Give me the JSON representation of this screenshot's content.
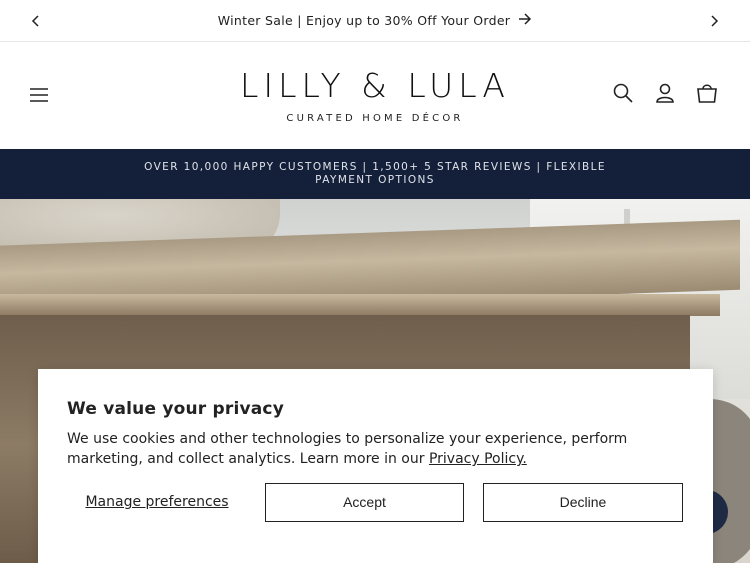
{
  "announcement": {
    "text": "Winter Sale | Enjoy up to 30% Off Your Order"
  },
  "header": {
    "brand": "LILLY & LULA",
    "tagline": "CURATED HOME DÉCOR"
  },
  "promo_bar": {
    "text": "OVER 10,000 HAPPY CUSTOMERS | 1,500+ 5 STAR REVIEWS | FLEXIBLE PAYMENT OPTIONS"
  },
  "cookie_banner": {
    "title": "We value your privacy",
    "body": "We use cookies and other technologies to personalize your experience, perform marketing, and collect analytics. Learn more in our",
    "policy_link": "Privacy Policy.",
    "manage_label": "Manage preferences",
    "accept_label": "Accept",
    "decline_label": "Decline"
  },
  "colors": {
    "promo_bg": "#14203a",
    "promo_text": "#dfe3ea",
    "text": "#222222"
  },
  "icons": [
    "chevron-left-icon",
    "chevron-right-icon",
    "arrow-right-icon",
    "menu-icon",
    "search-icon",
    "account-icon",
    "cart-icon",
    "chat-icon"
  ]
}
